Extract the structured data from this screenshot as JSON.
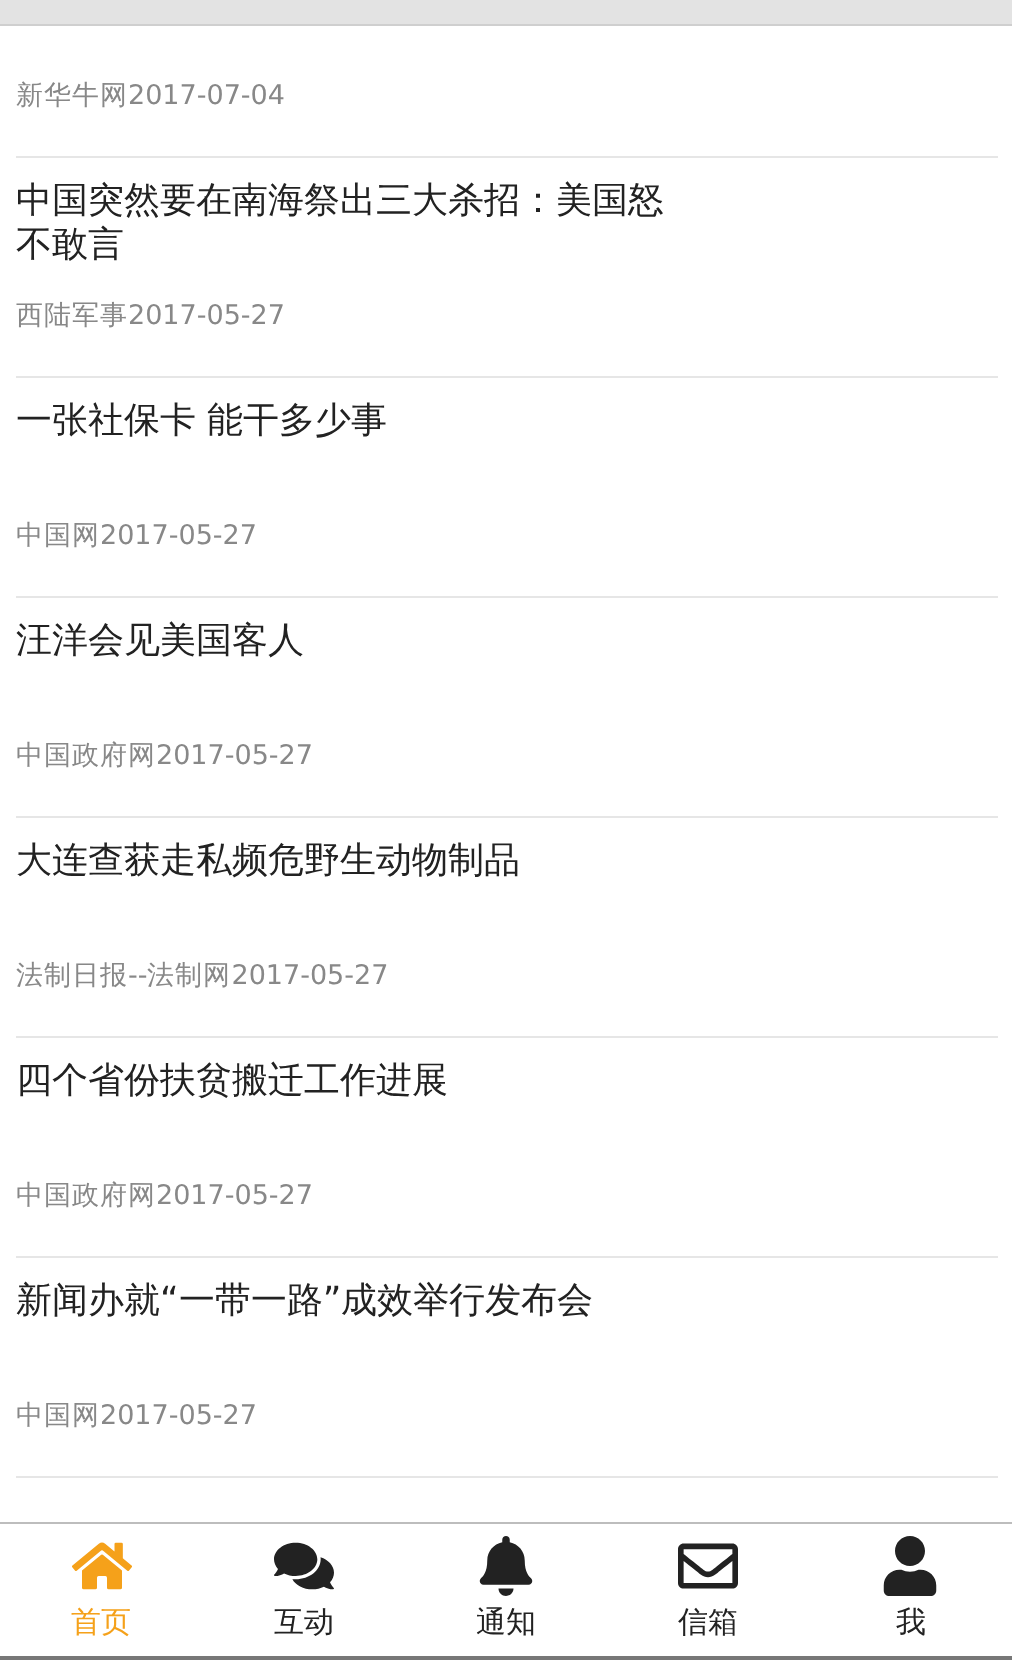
{
  "news": [
    {
      "source": "新华牛网2017-07-04"
    },
    {
      "title": "中国突然要在南海祭出三大杀招：美国怒不敢言",
      "source": "西陆军事2017-05-27"
    },
    {
      "title": "一张社保卡 能干多少事",
      "source": "中国网2017-05-27"
    },
    {
      "title": "汪洋会见美国客人",
      "source": "中国政府网2017-05-27"
    },
    {
      "title": "大连查获走私频危野生动物制品",
      "source": "法制日报--法制网2017-05-27"
    },
    {
      "title": "四个省份扶贫搬迁工作进展",
      "source": "中国政府网2017-05-27"
    },
    {
      "title": "新闻办就“一带一路”成效举行发布会",
      "source": "中国网2017-05-27"
    }
  ],
  "tabs": [
    {
      "label": "首页",
      "kind": "home",
      "selected": true
    },
    {
      "label": "互动",
      "kind": "chat",
      "selected": false
    },
    {
      "label": "通知",
      "kind": "bell",
      "selected": false
    },
    {
      "label": "信箱",
      "kind": "mail",
      "selected": false
    },
    {
      "label": "我",
      "kind": "user",
      "selected": false
    }
  ]
}
